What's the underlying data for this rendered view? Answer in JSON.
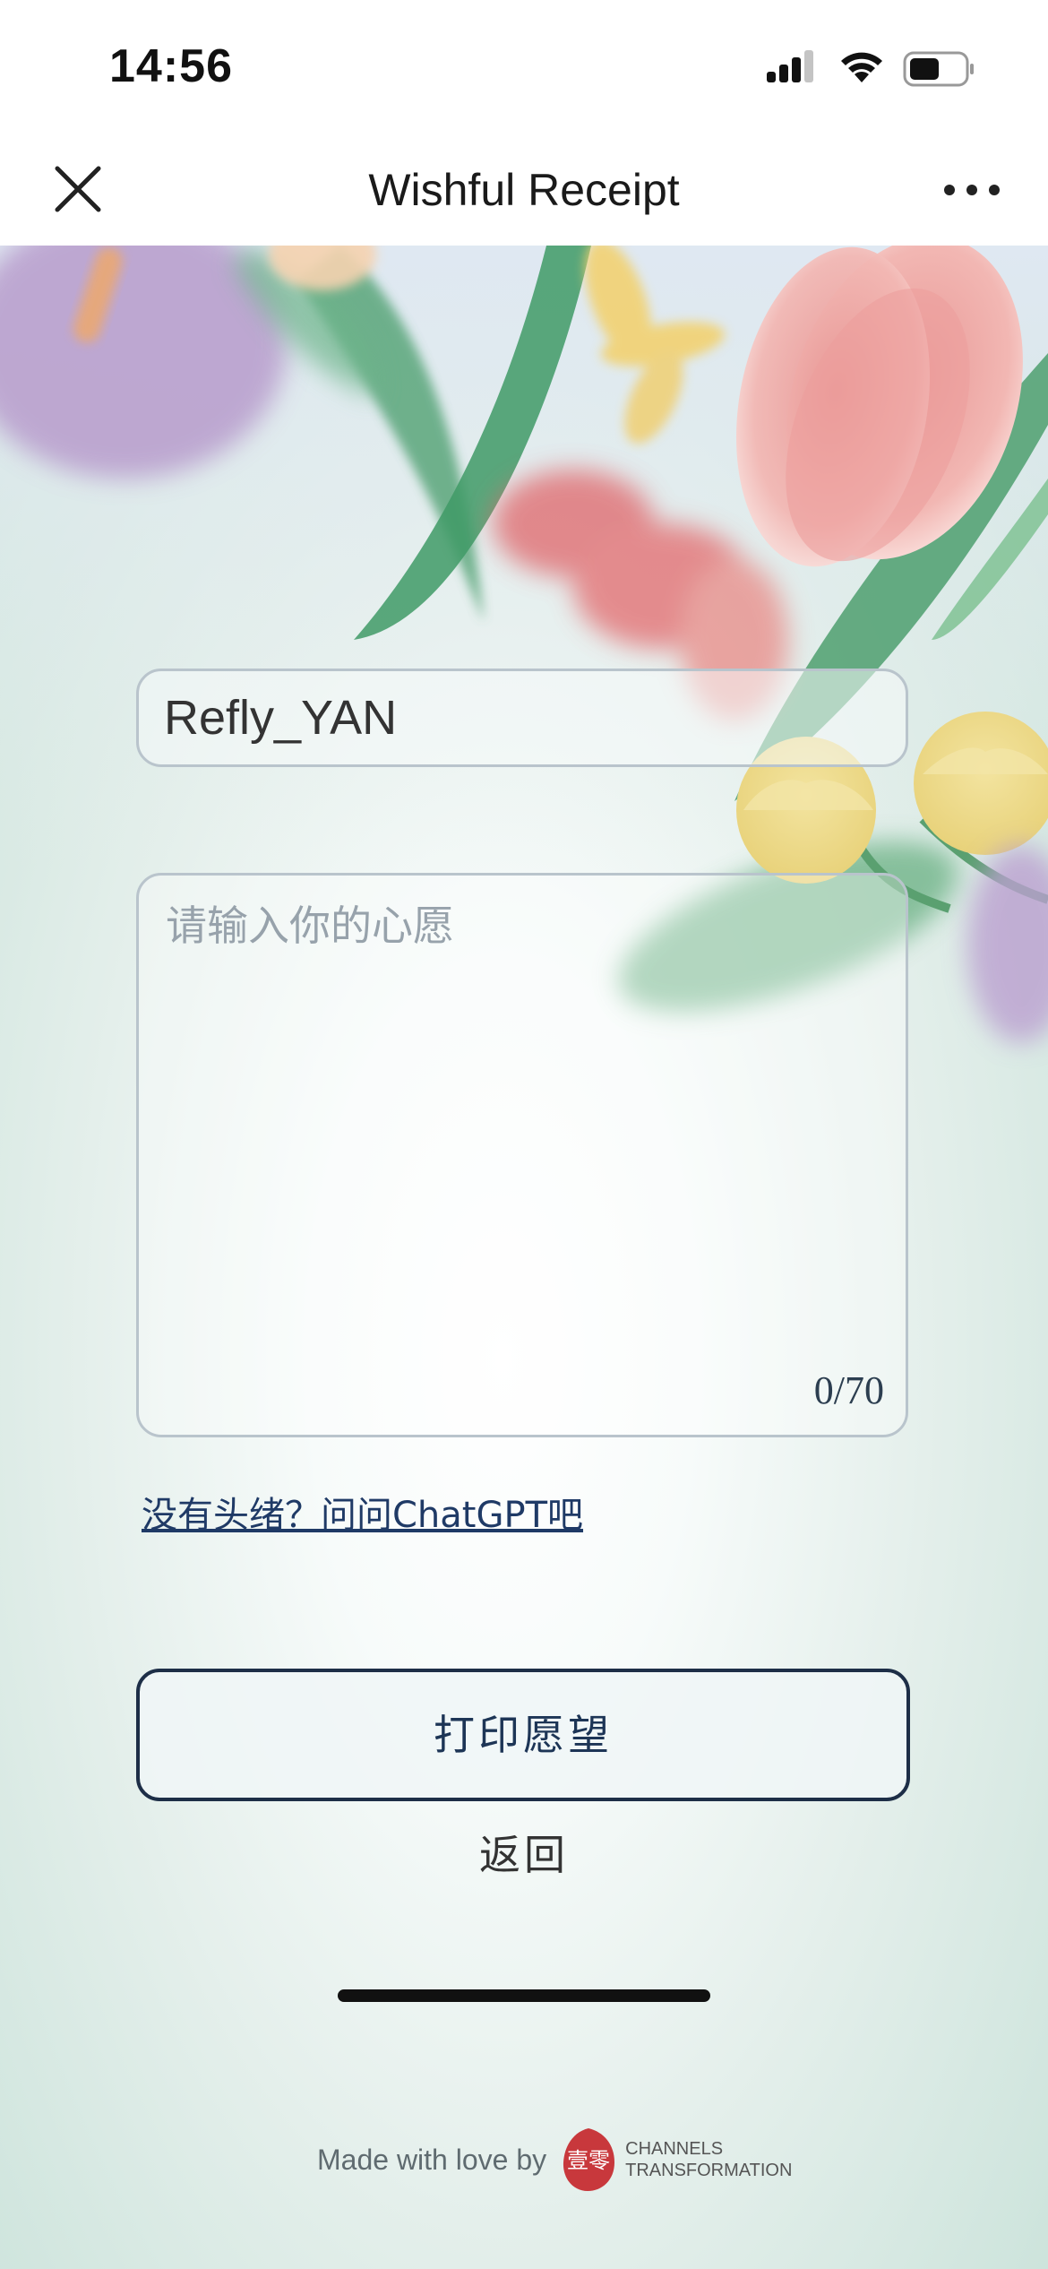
{
  "status_bar": {
    "time": "14:56"
  },
  "nav": {
    "title": "Wishful Receipt",
    "close_icon": "close-icon",
    "more_icon": "more-dots-icon"
  },
  "form": {
    "name_value": "Refly_YAN",
    "wish_placeholder": "请输入你的心愿",
    "wish_value": "",
    "char_count": "0/70"
  },
  "links": {
    "chatgpt": "没有头绪？问问ChatGPT吧"
  },
  "actions": {
    "print_label": "打印愿望",
    "back_label": "返回"
  },
  "footer": {
    "made_with": "Made with love by",
    "logo_glyphs": "壹零",
    "brand_line1": "CHANNELS",
    "brand_line2": "TRANSFORMATION"
  },
  "colors": {
    "accent": "#1d2e47",
    "link": "#1f3a66",
    "logo_red": "#c8383c"
  }
}
